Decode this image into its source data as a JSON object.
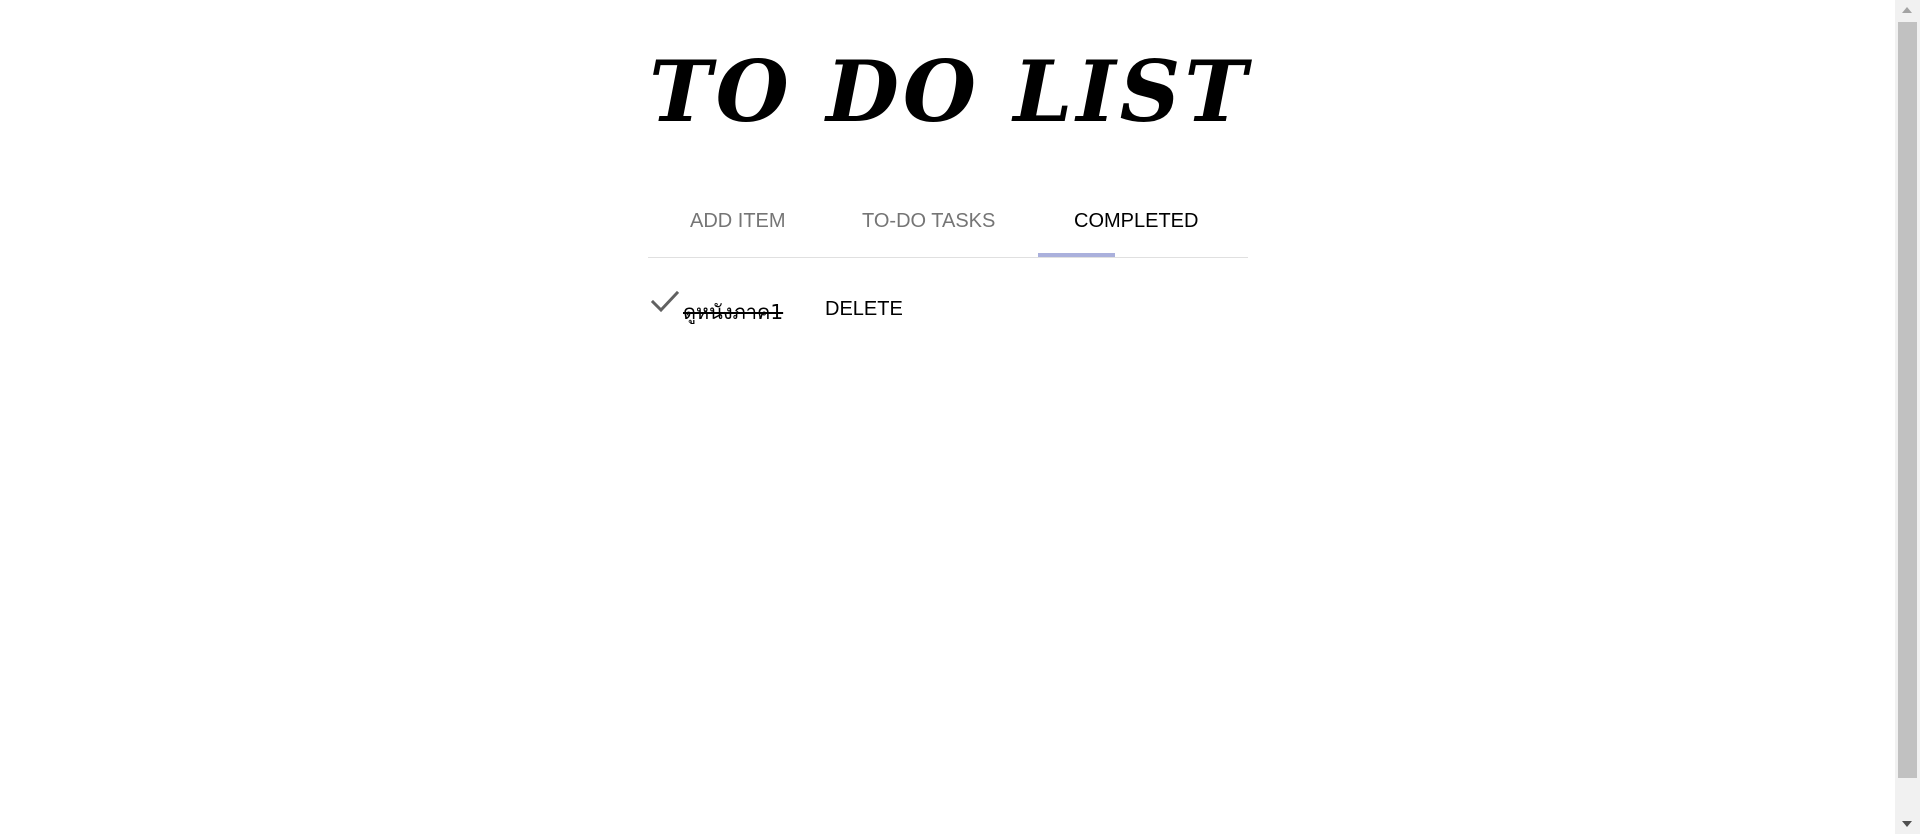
{
  "app": {
    "title": "TO DO LIST"
  },
  "tabs": [
    {
      "label": "ADD ITEM",
      "active": false
    },
    {
      "label": "TO-DO TASKS",
      "active": false
    },
    {
      "label": "COMPLETED",
      "active": true
    }
  ],
  "completed_items": [
    {
      "text": "ดูหนังภาค1",
      "done": true,
      "delete_label": "DELETE",
      "icon": "check-icon"
    }
  ],
  "colors": {
    "tab_indicator": "#aab0dc",
    "tab_inactive": "#757575",
    "tab_active": "#000000",
    "check_icon": "#616161"
  }
}
